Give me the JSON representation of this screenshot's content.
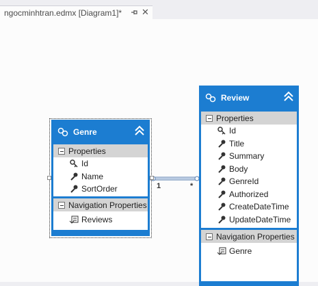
{
  "tab": {
    "title": "ngocminhtran.edmx [Diagram1]*",
    "pin_icon": "pin-icon",
    "close_symbol": "✕"
  },
  "colors": {
    "entity_blue": "#1c7dd1",
    "section_gray": "#d4d4d4",
    "canvas": "#fcfcfc",
    "chrome": "#eeeef2"
  },
  "entities": {
    "genre": {
      "name": "Genre",
      "properties_label": "Properties",
      "properties": [
        {
          "name": "Id",
          "icon": "key-icon"
        },
        {
          "name": "Name",
          "icon": "wrench-icon"
        },
        {
          "name": "SortOrder",
          "icon": "wrench-icon"
        }
      ],
      "nav_label": "Navigation Properties",
      "nav_properties": [
        {
          "name": "Reviews",
          "icon": "navigation-icon"
        }
      ]
    },
    "review": {
      "name": "Review",
      "properties_label": "Properties",
      "properties": [
        {
          "name": "Id",
          "icon": "key-icon"
        },
        {
          "name": "Title",
          "icon": "wrench-icon"
        },
        {
          "name": "Summary",
          "icon": "wrench-icon"
        },
        {
          "name": "Body",
          "icon": "wrench-icon"
        },
        {
          "name": "GenreId",
          "icon": "wrench-icon"
        },
        {
          "name": "Authorized",
          "icon": "wrench-icon"
        },
        {
          "name": "CreateDateTime",
          "icon": "wrench-icon"
        },
        {
          "name": "UpdateDateTime",
          "icon": "wrench-icon"
        }
      ],
      "nav_label": "Navigation Properties",
      "nav_properties": [
        {
          "name": "Genre",
          "icon": "navigation-icon"
        }
      ]
    }
  },
  "association": {
    "from_multiplicity": "1",
    "to_multiplicity": "*"
  }
}
